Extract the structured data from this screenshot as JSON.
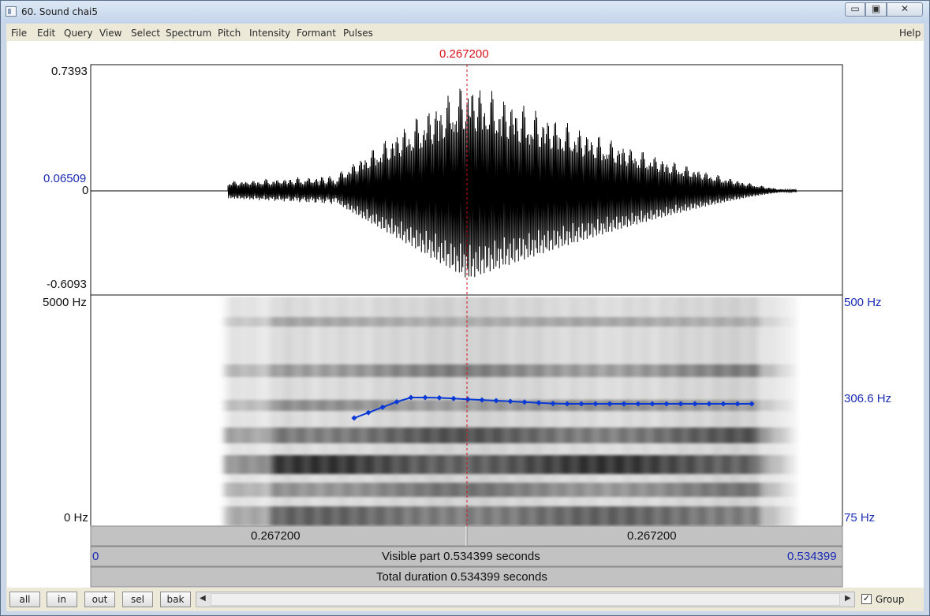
{
  "window": {
    "title": "60. Sound chai5"
  },
  "menu": [
    "File",
    "Edit",
    "Query",
    "View",
    "Select",
    "Spectrum",
    "Pitch",
    "Intensity",
    "Formant",
    "Pulses"
  ],
  "help": "Help",
  "cursor": {
    "time_label": "0.267200"
  },
  "waveform": {
    "max_label": "0.7393",
    "cursor_value_label": "0.06509",
    "zero_label": "0",
    "min_label": "-0.6093"
  },
  "spectrogram": {
    "top_label": "5000 Hz",
    "bottom_label": "0 Hz"
  },
  "pitch": {
    "top_label": "500 Hz",
    "mid_label": "306.6 Hz",
    "bottom_label": "75 Hz",
    "color": "#0a3ad6"
  },
  "time_bars": {
    "left_segment": "0.267200",
    "right_segment": "0.267200",
    "visible_start": "0",
    "visible_label": "Visible part 0.534399 seconds",
    "visible_end": "0.534399",
    "total_label": "Total duration 0.534399 seconds"
  },
  "buttons": {
    "all": "all",
    "in": "in",
    "out": "out",
    "sel": "sel",
    "bak": "bak"
  },
  "group": {
    "label": "Group",
    "checked": true
  }
}
